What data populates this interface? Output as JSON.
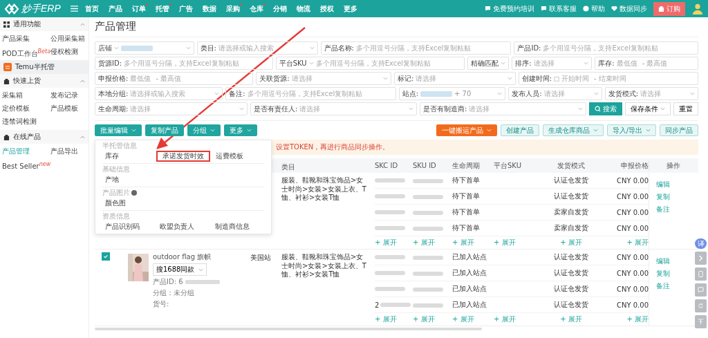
{
  "brand": {
    "name": "妙手ERP"
  },
  "nav": [
    {
      "label": "首页",
      "dot": false
    },
    {
      "label": "产品",
      "dot": false
    },
    {
      "label": "订单",
      "dot": true
    },
    {
      "label": "托管",
      "dot": true
    },
    {
      "label": "广告",
      "dot": false
    },
    {
      "label": "数据",
      "dot": false
    },
    {
      "label": "采购",
      "dot": true
    },
    {
      "label": "仓库",
      "dot": true
    },
    {
      "label": "分销",
      "dot": false
    },
    {
      "label": "物流",
      "dot": false
    },
    {
      "label": "授权",
      "dot": false
    },
    {
      "label": "更多",
      "dot": false
    }
  ],
  "top_links": [
    {
      "label": "免费预约培训",
      "kind": "chat"
    },
    {
      "label": "联系客服",
      "kind": "message"
    },
    {
      "label": "帮助",
      "kind": "help"
    },
    {
      "label": "数据同步",
      "kind": "sync"
    }
  ],
  "order_button": "订购",
  "sidebar": [
    {
      "title": "通用功能",
      "kind": "grid",
      "expanded": true,
      "items": [
        {
          "label": "产品采集",
          "selected": false
        },
        {
          "label": "公用采集箱",
          "selected": false
        },
        {
          "label": "POD工作台",
          "badge": "Beta",
          "selected": false
        },
        {
          "label": "侵权检测",
          "selected": false
        }
      ]
    },
    {
      "title": "Temu半托管",
      "kind": "temu",
      "highlight": true
    },
    {
      "title": "快速上货",
      "kind": "bag",
      "expanded": true,
      "items": [
        {
          "label": "采集箱",
          "selected": false
        },
        {
          "label": "发布记录",
          "selected": false
        },
        {
          "label": "定价模板",
          "selected": false
        },
        {
          "label": "产品模板",
          "selected": false
        },
        {
          "label": "违禁词检测",
          "selected": false
        }
      ]
    },
    {
      "title": "在线产品",
      "kind": "bag",
      "expanded": true,
      "items": [
        {
          "label": "产品管理",
          "selected": true
        },
        {
          "label": "产品导出",
          "selected": false
        },
        {
          "label": "Best Seller",
          "badge": "new",
          "selected": false
        }
      ]
    }
  ],
  "page_title": "产品管理",
  "filters": [
    [
      {
        "kind": "shop",
        "label": "店铺"
      },
      {
        "kind": "select",
        "label": "类目:",
        "placeholder": "请选择或输入搜索"
      },
      {
        "kind": "text",
        "label": "产品名称:",
        "placeholder": "多个用逗号分隔，支持Excel复制粘贴"
      },
      {
        "kind": "text",
        "label": "产品ID:",
        "placeholder": "多个用逗号分隔，支持Excel复制粘贴"
      }
    ],
    [
      {
        "kind": "text",
        "label": "货源ID:",
        "placeholder": "多个用逗号分隔，支持Excel复制粘贴"
      },
      {
        "kind": "sku",
        "label": "平台SKU",
        "placeholder": "多个用逗号分隔，支持Excel复制粘贴"
      },
      {
        "kind": "small",
        "value": "精确匹配"
      },
      {
        "kind": "select",
        "label": "排序:",
        "placeholder": "请选择"
      },
      {
        "kind": "range",
        "label": "库存:",
        "placeholder": "最低值",
        "separator": "-",
        "placeholder_end": "最高值"
      }
    ],
    [
      {
        "kind": "range",
        "label": "申报价格:",
        "placeholder": "最低值",
        "separator": "-",
        "placeholder_end": "最高值"
      },
      {
        "kind": "select",
        "label": "关联货源:",
        "placeholder": "请选择"
      },
      {
        "kind": "select",
        "label": "标记:",
        "placeholder": "请选择"
      },
      {
        "kind": "date",
        "label": "创建时间:",
        "placeholder": "开始时间",
        "separator": "-",
        "placeholder_end": "结束时间"
      }
    ],
    [
      {
        "kind": "select",
        "label": "本地分组:",
        "placeholder": "请选择或输入搜索"
      },
      {
        "kind": "text",
        "label": "备注:",
        "placeholder": "多个用逗号分隔，支持Excel复制粘贴"
      },
      {
        "kind": "tags",
        "label": "站点:",
        "value": "+ 70"
      },
      {
        "kind": "select",
        "label": "发布人员:",
        "placeholder": "请选择"
      },
      {
        "kind": "select",
        "label": "发货模式:",
        "placeholder": "请选择"
      }
    ],
    [
      {
        "kind": "select",
        "label": "生命周期:",
        "placeholder": "请选择"
      },
      {
        "kind": "select",
        "label": "是否有责任人:",
        "placeholder": "请选择"
      },
      {
        "kind": "select",
        "label": "是否有制造商:",
        "placeholder": "请选择"
      }
    ]
  ],
  "filter_buttons": [
    {
      "label": "搜索",
      "kind": "primary"
    },
    {
      "label": "保存条件",
      "kind": "dropdown"
    },
    {
      "label": "重置",
      "kind": "plain"
    }
  ],
  "left_actions": [
    {
      "label": "批量编辑",
      "caret": true
    },
    {
      "label": "复制产品",
      "caret": false
    },
    {
      "label": "分组",
      "caret": true
    },
    {
      "label": "更多",
      "caret": true
    }
  ],
  "right_actions": [
    {
      "label": "一键搬运产品",
      "kind": "orange",
      "caret": true
    },
    {
      "label": "创建产品",
      "kind": "light",
      "caret": false
    },
    {
      "label": "生成仓库商品",
      "kind": "light",
      "caret": true
    },
    {
      "label": "导入/导出",
      "kind": "light",
      "caret": true
    },
    {
      "label": "同步产品",
      "kind": "light",
      "caret": false
    }
  ],
  "notice": "设置TOKEN，再进行商品同步操作。",
  "menu": [
    {
      "title": "半托管信息",
      "help": false,
      "items": [
        {
          "label": "库存",
          "highlighted": false
        },
        {
          "label": "承诺发货时效",
          "highlighted": true
        },
        {
          "label": "运费模板",
          "highlighted": false
        }
      ]
    },
    {
      "title": "基础信息",
      "help": false,
      "items": [
        {
          "label": "产地",
          "highlighted": false
        }
      ]
    },
    {
      "title": "产品图片",
      "help": true,
      "items": [
        {
          "label": "颜色图",
          "highlighted": false
        }
      ]
    },
    {
      "title": "资质信息",
      "help": false,
      "items": [
        {
          "label": "产品识别码",
          "highlighted": false
        },
        {
          "label": "欧盟负责人",
          "highlighted": false
        },
        {
          "label": "制造商信息",
          "highlighted": false
        }
      ]
    }
  ],
  "table": {
    "columns": [
      "类目",
      "SKC ID",
      "SKU ID",
      "生命周期",
      "平台SKU",
      "发货模式",
      "申报价格",
      "操作"
    ],
    "rows": [
      {
        "category": "服装、鞋靴和珠宝饰品>女士时尚>女装>女装上衣、T恤、衬衫>女装T恤",
        "skus": [
          {
            "lifecycle": "待下首单",
            "shipping": "认证仓发货",
            "price": "CNY 0.00"
          },
          {
            "lifecycle": "待下首单",
            "shipping": "认证仓发货",
            "price": "CNY 0.00"
          },
          {
            "lifecycle": "待下首单",
            "shipping": "卖家自发货",
            "price": "CNY 0.00"
          },
          {
            "lifecycle": "待下首单",
            "shipping": "卖家自发货",
            "price": "CNY 0.00"
          }
        ],
        "expand": [
          "+ 展开",
          "+ 展开",
          "+ 展开",
          "+ 展开",
          "+ 展开",
          "+ 展开"
        ],
        "actions": [
          "编辑",
          "复制",
          "备注"
        ]
      },
      {
        "checked": true,
        "title": "outdoor flag 旗帜",
        "search_button": "搜1688同款",
        "id_label": "产品ID: 6",
        "group": "分组：未分组",
        "code_label": "货号:",
        "site": "美国站",
        "category": "服装、鞋靴和珠宝饰品>女士时尚>女装>女装上衣、T恤、衬衫>女装T恤",
        "skus": [
          {
            "lifecycle": "已加入站点",
            "shipping": "认证仓发货",
            "price": "CNY 0.00"
          },
          {
            "lifecycle": "已加入站点",
            "shipping": "认证仓发货",
            "price": "CNY 0.00"
          },
          {
            "lifecycle": "已加入站点",
            "shipping": "认证仓发货",
            "price": "CNY 0.00"
          },
          {
            "skc": "2",
            "lifecycle": "已加入站点",
            "shipping": "认证仓发货",
            "price": "CNY 0.00"
          }
        ],
        "expand": [
          "+ 展开",
          "+ 展开",
          "+ 展开",
          "+ 展开",
          "+ 展开",
          "+ 展开"
        ],
        "actions": [
          "编辑",
          "复制",
          "备注"
        ]
      }
    ]
  },
  "float_tools": [
    {
      "kind": "translate",
      "label": "译"
    },
    {
      "kind": "chevron"
    },
    {
      "kind": "phone"
    },
    {
      "kind": "chat"
    },
    {
      "kind": "refresh"
    },
    {
      "kind": "top"
    }
  ]
}
